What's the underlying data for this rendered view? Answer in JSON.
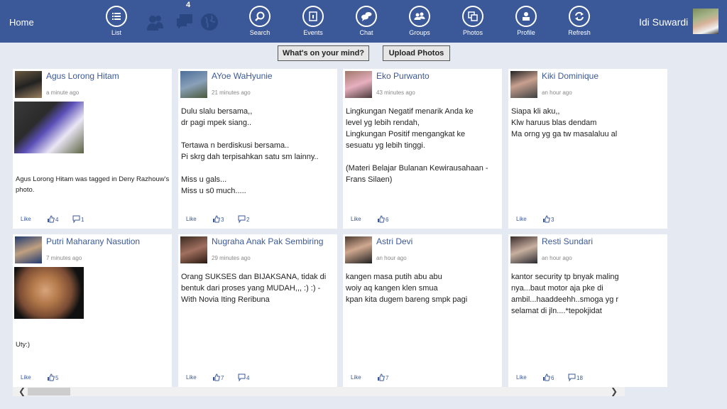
{
  "topbar": {
    "home_label": "Home",
    "nav": [
      {
        "label": "List",
        "icon": "list-icon"
      },
      {
        "label": "Search",
        "icon": "search-icon"
      },
      {
        "label": "Events",
        "icon": "calendar-icon"
      },
      {
        "label": "Chat",
        "icon": "chat-icon"
      },
      {
        "label": "Groups",
        "icon": "groups-icon"
      },
      {
        "label": "Photos",
        "icon": "photos-icon"
      },
      {
        "label": "Profile",
        "icon": "profile-icon"
      },
      {
        "label": "Refresh",
        "icon": "refresh-icon"
      }
    ],
    "notifications": {
      "friend_requests_icon": "friends-icon",
      "messages_icon": "messages-icon",
      "messages_badge": "4",
      "global_icon": "globe-icon"
    },
    "user_name": "Idi Suwardi"
  },
  "actions": {
    "status_label": "What's on your mind?",
    "upload_label": "Upload Photos"
  },
  "colors": {
    "brand": "#3b5998",
    "background": "#e5e9f2"
  },
  "posts": [
    {
      "name": "Agus Lorong Hitam",
      "time": "a minute ago",
      "has_photo": true,
      "text": "Agus Lorong Hitam was tagged in Deny Razhouw's photo.",
      "like_label": "Like",
      "likes": "4",
      "comments": "1"
    },
    {
      "name": "AYoe WaHyunie",
      "time": "21 minutes ago",
      "has_photo": false,
      "text": "Dulu slalu bersama,,\ndr pagi mpek siang..\n\nTertawa n berdiskusi bersama..\nPi skrg dah terpisahkan satu sm lainny..\n\nMiss u gals...\nMiss u s0 much.....",
      "like_label": "Like",
      "likes": "3",
      "comments": "2"
    },
    {
      "name": "Eko Purwanto",
      "time": "43 minutes ago",
      "has_photo": false,
      "text": "Lingkungan Negatif menarik Anda ke\nlevel yg lebih rendah,\nLingkungan Positif mengangkat ke\nsesuatu yg lebih tinggi.\n\n(Materi Belajar Bulanan Kewirausahaan -\nFrans Silaen)",
      "like_label": "Like",
      "likes": "6",
      "comments": null
    },
    {
      "name": "Kiki Dominique",
      "time": "an hour ago",
      "has_photo": false,
      "text": "Siapa kli aku,,\nKlw haruus blas dendam\nMa orng yg ga tw masalaluu al",
      "like_label": "Like",
      "likes": "3",
      "comments": null
    },
    {
      "name": "Putri Maharany Nasution",
      "time": "7 minutes ago",
      "has_photo": true,
      "text": "Uty:)",
      "like_label": "Like",
      "likes": "5",
      "comments": null
    },
    {
      "name": "Nugraha Anak Pak Sembiring",
      "time": "29 minutes ago",
      "has_photo": false,
      "text": "Orang SUKSES dan BIJAKSANA, tidak di\nbentuk dari proses yang MUDAH,,, :) :) -\nWith Novia Iting Reribuna",
      "like_label": "Like",
      "likes": "7",
      "comments": "4"
    },
    {
      "name": "Astri Devi",
      "time": "an hour ago",
      "has_photo": false,
      "text": "kangen masa putih abu abu\nwoiy aq kangen klen smua\nkpan kita dugem bareng smpk pagi",
      "like_label": "Like",
      "likes": "7",
      "comments": null
    },
    {
      "name": "Resti Sundari",
      "time": "an hour ago",
      "has_photo": false,
      "text": "kantor security tp bnyak maling\nnya...baut motor aja pke di\nambil...haaddeehh..smoga yg r\nselamat di jln....*tepokjidat",
      "like_label": "Like",
      "likes": "6",
      "comments": "18"
    }
  ],
  "scrollbar": {
    "left_icon": "chevron-left-icon",
    "right_icon": "chevron-right-icon"
  }
}
